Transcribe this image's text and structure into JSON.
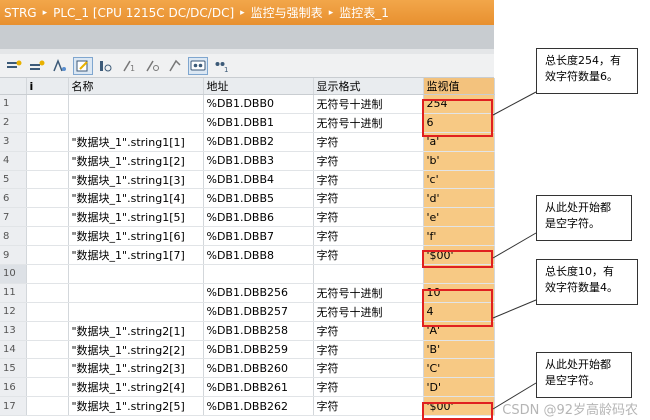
{
  "breadcrumb": {
    "items": [
      "STRG",
      "PLC_1 [CPU 1215C DC/DC/DC]",
      "监控与强制表",
      "监控表_1"
    ]
  },
  "toolbar": {
    "icons": [
      "insert-row-icon",
      "add-row-icon",
      "update-icon",
      "modify-icon",
      "show-all-icon",
      "modify-value-icon",
      "modify-now-icon",
      "force-icon",
      "monitor-all-icon",
      "monitor-once-icon"
    ]
  },
  "table": {
    "headers": [
      "",
      "i",
      "名称",
      "地址",
      "显示格式",
      "监视值"
    ],
    "rows": [
      {
        "n": "1",
        "name": "",
        "addr": "%DB1.DBB0",
        "fmt": "无符号十进制",
        "val": "254"
      },
      {
        "n": "2",
        "name": "",
        "addr": "%DB1.DBB1",
        "fmt": "无符号十进制",
        "val": "6"
      },
      {
        "n": "3",
        "name": "\"数据块_1\".string1[1]",
        "addr": "%DB1.DBB2",
        "fmt": "字符",
        "val": "'a'"
      },
      {
        "n": "4",
        "name": "\"数据块_1\".string1[2]",
        "addr": "%DB1.DBB3",
        "fmt": "字符",
        "val": "'b'"
      },
      {
        "n": "5",
        "name": "\"数据块_1\".string1[3]",
        "addr": "%DB1.DBB4",
        "fmt": "字符",
        "val": "'c'"
      },
      {
        "n": "6",
        "name": "\"数据块_1\".string1[4]",
        "addr": "%DB1.DBB5",
        "fmt": "字符",
        "val": "'d'"
      },
      {
        "n": "7",
        "name": "\"数据块_1\".string1[5]",
        "addr": "%DB1.DBB6",
        "fmt": "字符",
        "val": "'e'"
      },
      {
        "n": "8",
        "name": "\"数据块_1\".string1[6]",
        "addr": "%DB1.DBB7",
        "fmt": "字符",
        "val": "'f'"
      },
      {
        "n": "9",
        "name": "\"数据块_1\".string1[7]",
        "addr": "%DB1.DBB8",
        "fmt": "字符",
        "val": "'$00'"
      },
      {
        "n": "10",
        "name": "",
        "addr": "",
        "fmt": "",
        "val": ""
      },
      {
        "n": "11",
        "name": "",
        "addr": "%DB1.DBB256",
        "fmt": "无符号十进制",
        "val": "10"
      },
      {
        "n": "12",
        "name": "",
        "addr": "%DB1.DBB257",
        "fmt": "无符号十进制",
        "val": "4"
      },
      {
        "n": "13",
        "name": "\"数据块_1\".string2[1]",
        "addr": "%DB1.DBB258",
        "fmt": "字符",
        "val": "'A'"
      },
      {
        "n": "14",
        "name": "\"数据块_1\".string2[2]",
        "addr": "%DB1.DBB259",
        "fmt": "字符",
        "val": "'B'"
      },
      {
        "n": "15",
        "name": "\"数据块_1\".string2[3]",
        "addr": "%DB1.DBB260",
        "fmt": "字符",
        "val": "'C'"
      },
      {
        "n": "16",
        "name": "\"数据块_1\".string2[4]",
        "addr": "%DB1.DBB261",
        "fmt": "字符",
        "val": "'D'"
      },
      {
        "n": "17",
        "name": "\"数据块_1\".string2[5]",
        "addr": "%DB1.DBB262",
        "fmt": "字符",
        "val": "'$00'"
      }
    ]
  },
  "callouts": {
    "c1": [
      "总长度254，有",
      "效字符数量6。"
    ],
    "c2": [
      "从此处开始都",
      "是空字符。"
    ],
    "c3": [
      "总长度10，有",
      "效字符数量4。"
    ],
    "c4": [
      "从此处开始都",
      "是空字符。"
    ]
  },
  "watermark": "CSDN @92岁高龄码农",
  "colors": {
    "title_bar": "#e8902f",
    "monitor_column": "#f7c984",
    "highlight_border": "#e02020"
  }
}
